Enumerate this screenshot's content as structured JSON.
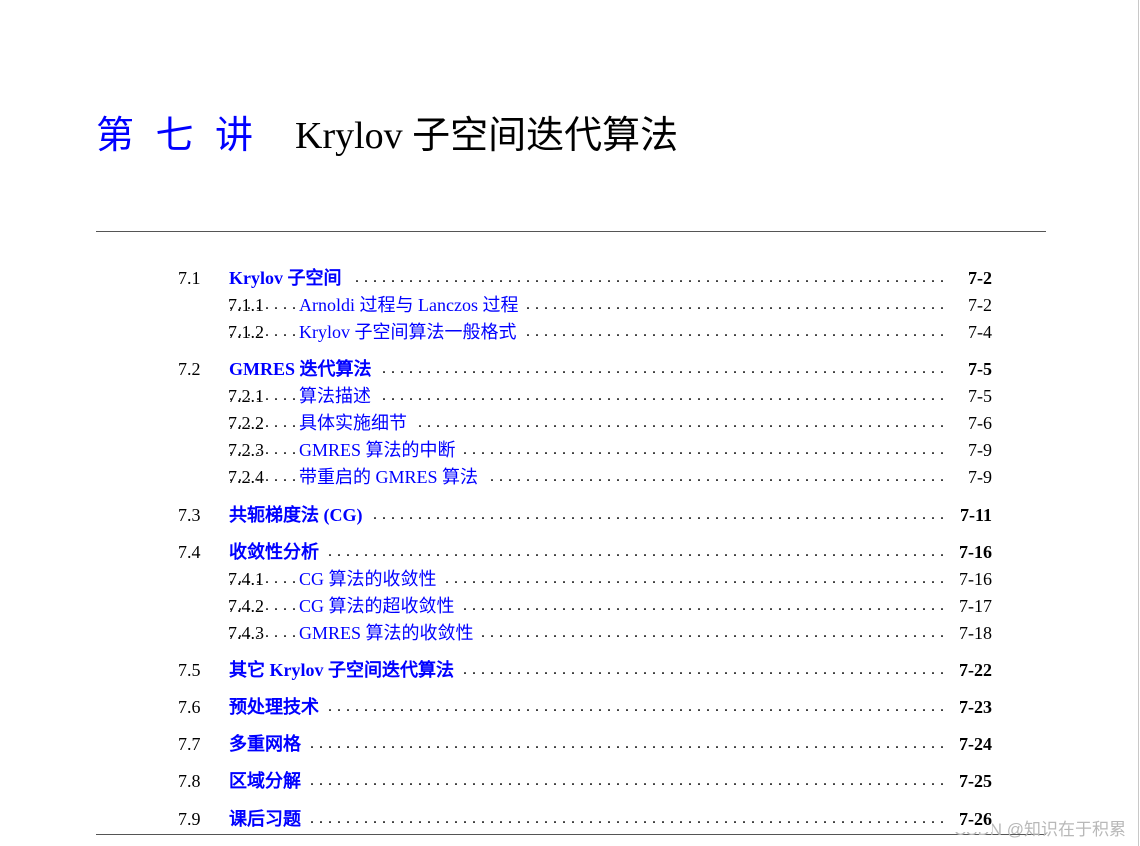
{
  "chapter": {
    "label": "第 七 讲",
    "title": "Krylov 子空间迭代算法"
  },
  "toc": [
    {
      "num": "7.1",
      "title": "Krylov 子空间",
      "page": "7-2",
      "level": 1
    },
    {
      "num": "7.1.1",
      "title": "Arnoldi 过程与 Lanczos 过程",
      "page": "7-2",
      "level": 2
    },
    {
      "num": "7.1.2",
      "title": "Krylov 子空间算法一般格式",
      "page": "7-4",
      "level": 2
    },
    {
      "num": "7.2",
      "title": "GMRES 迭代算法",
      "page": "7-5",
      "level": 1
    },
    {
      "num": "7.2.1",
      "title": "算法描述",
      "page": "7-5",
      "level": 2
    },
    {
      "num": "7.2.2",
      "title": "具体实施细节",
      "page": "7-6",
      "level": 2
    },
    {
      "num": "7.2.3",
      "title": "GMRES 算法的中断",
      "page": "7-9",
      "level": 2
    },
    {
      "num": "7.2.4",
      "title": "带重启的 GMRES 算法",
      "page": "7-9",
      "level": 2
    },
    {
      "num": "7.3",
      "title": "共轭梯度法 (CG)",
      "page": "7-11",
      "level": 1
    },
    {
      "num": "7.4",
      "title": "收敛性分析",
      "page": "7-16",
      "level": 1
    },
    {
      "num": "7.4.1",
      "title": "CG 算法的收敛性",
      "page": "7-16",
      "level": 2
    },
    {
      "num": "7.4.2",
      "title": "CG 算法的超收敛性",
      "page": "7-17",
      "level": 2
    },
    {
      "num": "7.4.3",
      "title": "GMRES 算法的收敛性",
      "page": "7-18",
      "level": 2
    },
    {
      "num": "7.5",
      "title": "其它 Krylov 子空间迭代算法",
      "page": "7-22",
      "level": 1
    },
    {
      "num": "7.6",
      "title": "预处理技术",
      "page": "7-23",
      "level": 1
    },
    {
      "num": "7.7",
      "title": "多重网格",
      "page": "7-24",
      "level": 1
    },
    {
      "num": "7.8",
      "title": "区域分解",
      "page": "7-25",
      "level": 1
    },
    {
      "num": "7.9",
      "title": "课后习题",
      "page": "7-26",
      "level": 1
    }
  ],
  "watermark": "CSDN @知识在于积累",
  "colors": {
    "link": "#0000ff",
    "text": "#000000",
    "watermark": "#b8b8b8"
  }
}
